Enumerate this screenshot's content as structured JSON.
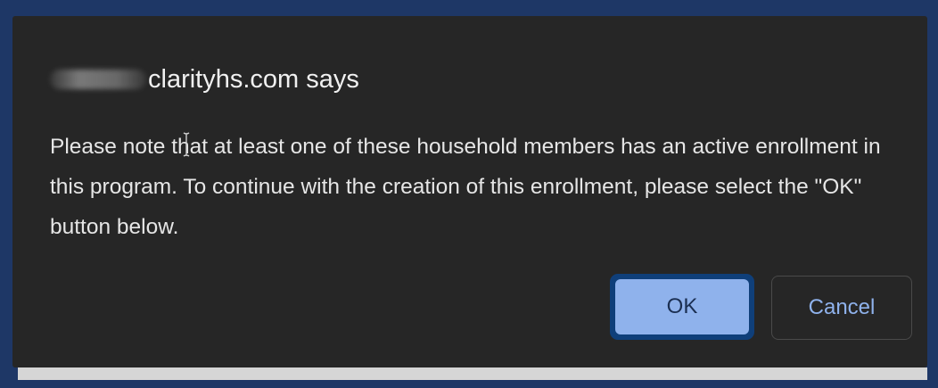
{
  "dialog": {
    "title_suffix": "clarityhs.com says",
    "message": "Please note that at least one of these household members has an active enrollment in this program. To continue with the creation of this enrollment, please select the \"OK\" button below.",
    "ok_label": "OK",
    "cancel_label": "Cancel"
  },
  "colors": {
    "dialog_background": "#262626",
    "frame": "#1e3766",
    "ok_button": "#8fb2ec",
    "cancel_text": "#8fb2ec"
  },
  "icons": {
    "text_cursor": "i-beam-cursor-icon"
  }
}
